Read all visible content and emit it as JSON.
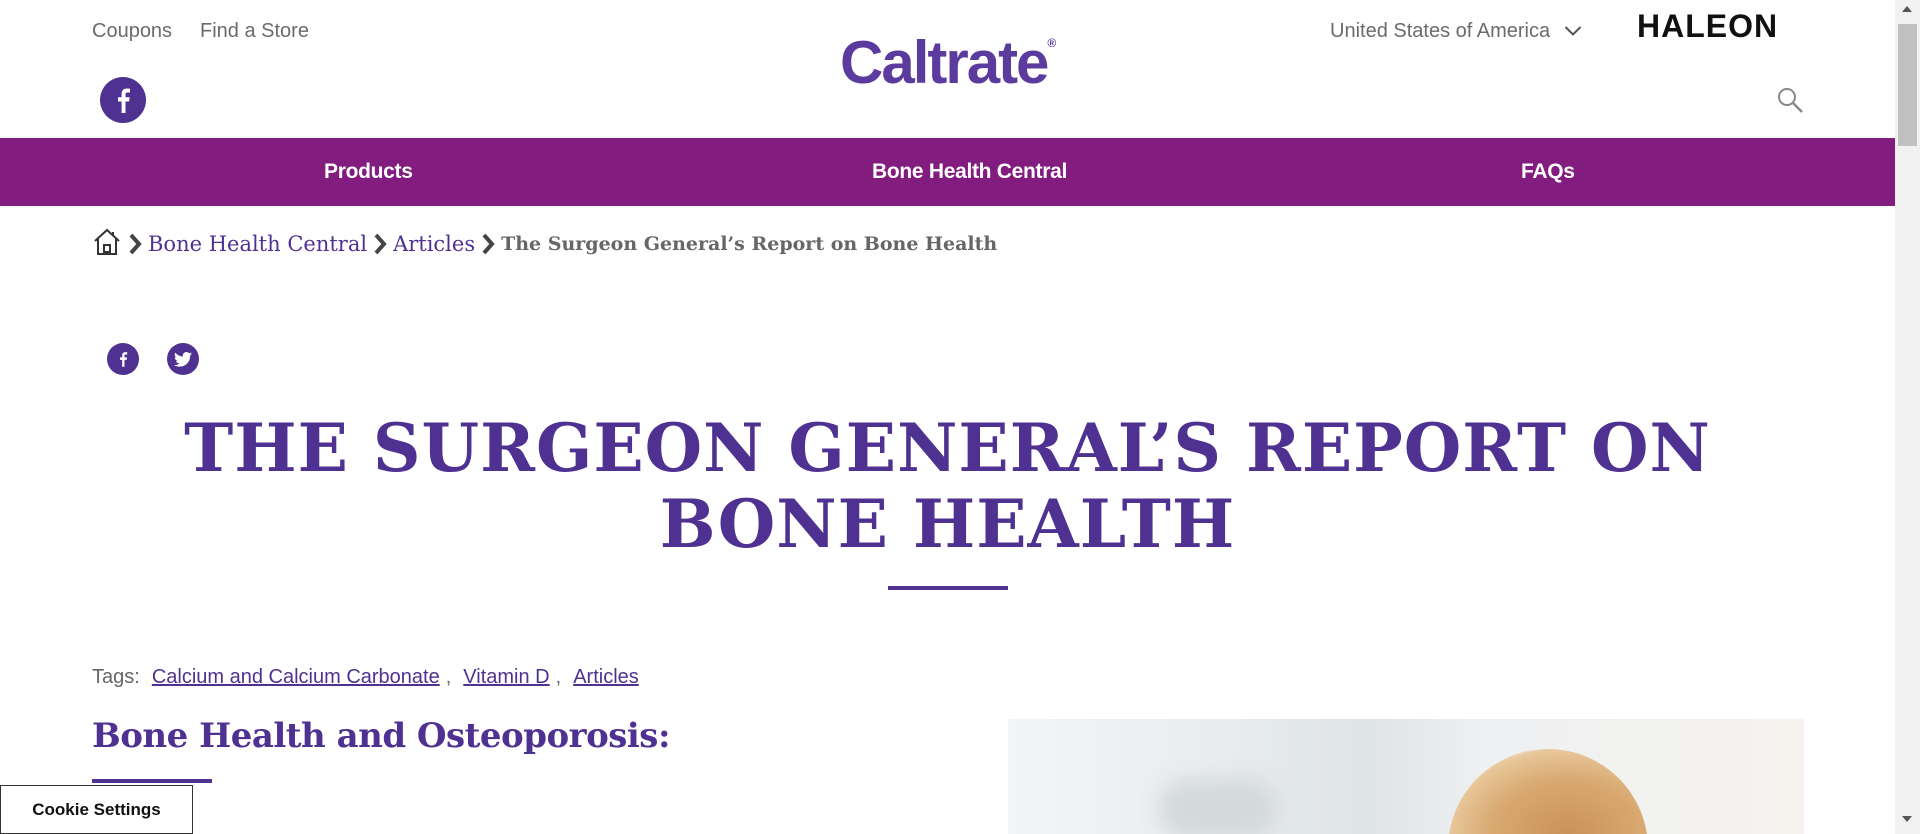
{
  "utility": {
    "coupons": "Coupons",
    "find_store": "Find a Store",
    "country": "United States of America",
    "corporate_logo": "HALEON"
  },
  "brand": {
    "logo_text": "Caltrate",
    "registered": "®"
  },
  "nav": {
    "items": [
      {
        "label": "Products"
      },
      {
        "label": "Bone Health Central"
      },
      {
        "label": "FAQs"
      }
    ]
  },
  "breadcrumb": {
    "items": [
      {
        "label": "Bone Health Central"
      },
      {
        "label": "Articles"
      }
    ],
    "current": "The Surgeon General’s Report on Bone Health"
  },
  "article": {
    "title": "THE SURGEON GENERAL’S REPORT ON BONE HEALTH",
    "tags_label": "Tags:",
    "tags": [
      "Calcium and Calcium Carbonate",
      "Vitamin D",
      "Articles"
    ],
    "section_title": "Bone Health and Osteoporosis:"
  },
  "cookie": {
    "label": "Cookie Settings"
  },
  "colors": {
    "brand_purple": "#4f3192",
    "nav_magenta": "#821d7f",
    "text_gray": "#666666"
  },
  "icons": [
    "facebook-icon",
    "twitter-icon",
    "home-icon",
    "chevron-right-icon",
    "chevron-down-icon",
    "search-icon"
  ]
}
